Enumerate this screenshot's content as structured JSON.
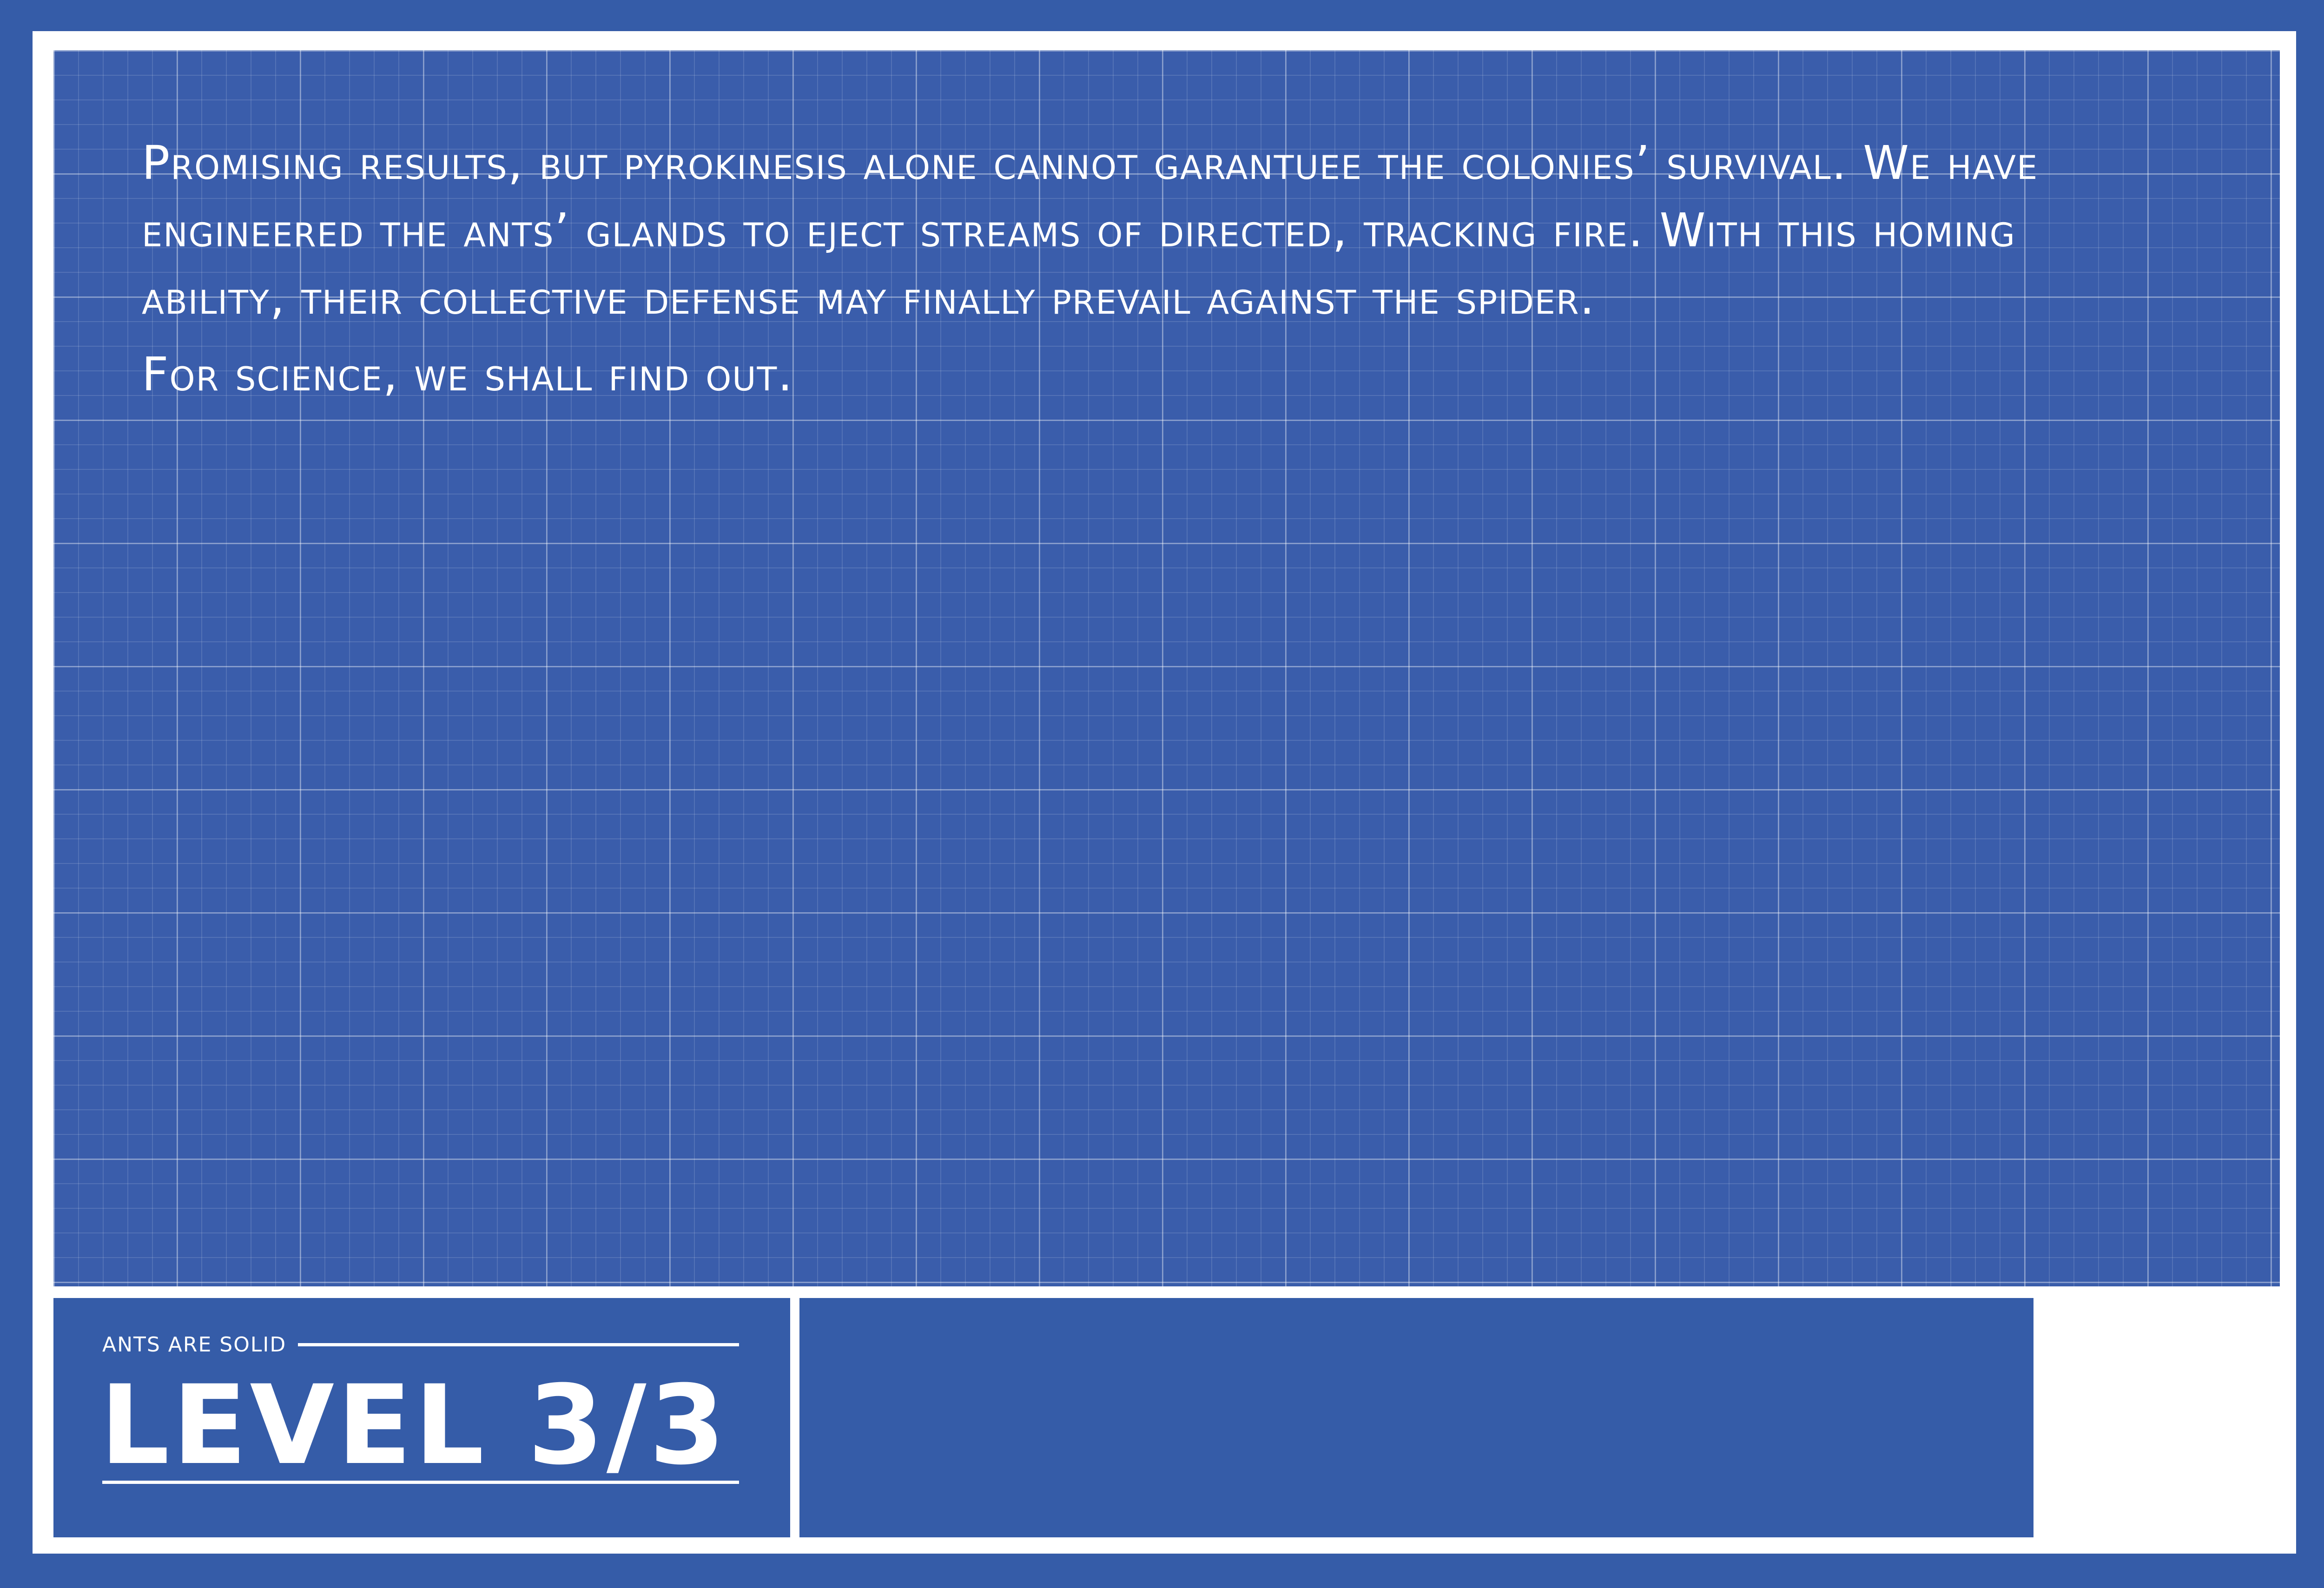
{
  "story": {
    "paragraph1": "Promising results, but pyrokinesis alone cannot garantuee the colonies’ survival. We have engineered the ants’ glands to eject streams of directed, tracking fire. With this homing ability, their collective defense may finally prevail against the spider.",
    "paragraph2": "For science, we shall find out."
  },
  "title_block": {
    "game_name": "ants are solid",
    "level_label": "LEVEL 3/3"
  },
  "colors": {
    "background": "#355ca8",
    "grid_panel": "#3a5dab",
    "frame": "#ffffff",
    "text": "#ffffff"
  }
}
